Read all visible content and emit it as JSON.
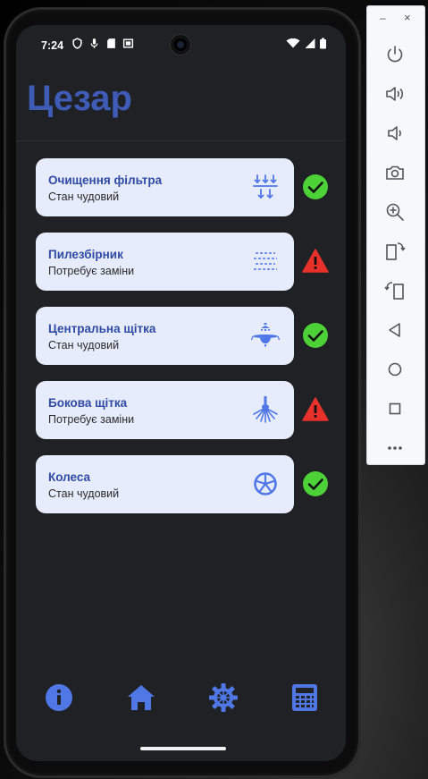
{
  "status_bar": {
    "time": "7:24"
  },
  "app": {
    "title": "Цезар"
  },
  "items": [
    {
      "title": "Очищення фільтра",
      "status": "Стан чудовий",
      "icon": "filter-icon",
      "state": "ok"
    },
    {
      "title": "Пилезбірник",
      "status": "Потребує заміни",
      "icon": "dust-bin-icon",
      "state": "warning"
    },
    {
      "title": "Центральна щітка",
      "status": "Стан чудовий",
      "icon": "main-brush-icon",
      "state": "ok"
    },
    {
      "title": "Бокова щітка",
      "status": "Потребує заміни",
      "icon": "side-brush-icon",
      "state": "warning"
    },
    {
      "title": "Колеса",
      "status": "Стан чудовий",
      "icon": "wheel-icon",
      "state": "ok"
    }
  ],
  "bottom_nav": [
    "info-icon",
    "home-icon",
    "gear-icon",
    "calculator-icon"
  ],
  "colors": {
    "accent": "#3e5bb5",
    "nav_icon": "#4f77e6",
    "ok": "#4cd137",
    "warning": "#e8312a",
    "card_bg": "#e6ecfb",
    "screen_bg": "#202124"
  },
  "emulator_toolbar": {
    "minimize": "–",
    "close": "×",
    "buttons": [
      "power-icon",
      "volume-up-icon",
      "volume-down-icon",
      "camera-icon",
      "zoom-icon",
      "rotate-left-icon",
      "rotate-right-icon",
      "back-icon",
      "home-circle-icon",
      "overview-icon",
      "more-icon"
    ]
  }
}
